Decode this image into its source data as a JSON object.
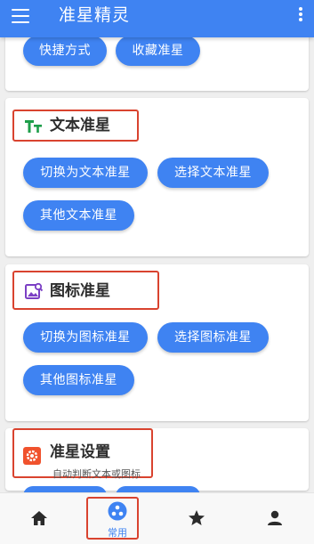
{
  "appbar": {
    "title": "准星精灵",
    "menu_icon": "menu-icon",
    "more_icon": "more-vert-icon"
  },
  "sections": {
    "shortcuts": {
      "buttons": [
        "快捷方式",
        "收藏准星"
      ]
    },
    "text_crosshair": {
      "title": "文本准星",
      "icon": "text-format-icon",
      "icon_color": "#1e9e4a",
      "buttons": [
        "切换为文本准星",
        "选择文本准星",
        "其他文本准星"
      ]
    },
    "image_crosshair": {
      "title": "图标准星",
      "icon": "image-search-icon",
      "icon_color": "#7b3fc4",
      "buttons": [
        "切换为图标准星",
        "选择图标准星",
        "其他图标准星"
      ]
    },
    "settings": {
      "title": "准星设置",
      "subtitle": "自动判断文本或图标",
      "icon": "settings-icon",
      "icon_color": "#f0522d"
    }
  },
  "bottom_nav": {
    "items": [
      {
        "icon": "home-icon",
        "label": ""
      },
      {
        "icon": "common-icon",
        "label": "常用",
        "active": true
      },
      {
        "icon": "star-icon",
        "label": ""
      },
      {
        "icon": "person-icon",
        "label": ""
      }
    ]
  },
  "colors": {
    "primary": "#3f83f2",
    "highlight_border": "#d9432f"
  }
}
